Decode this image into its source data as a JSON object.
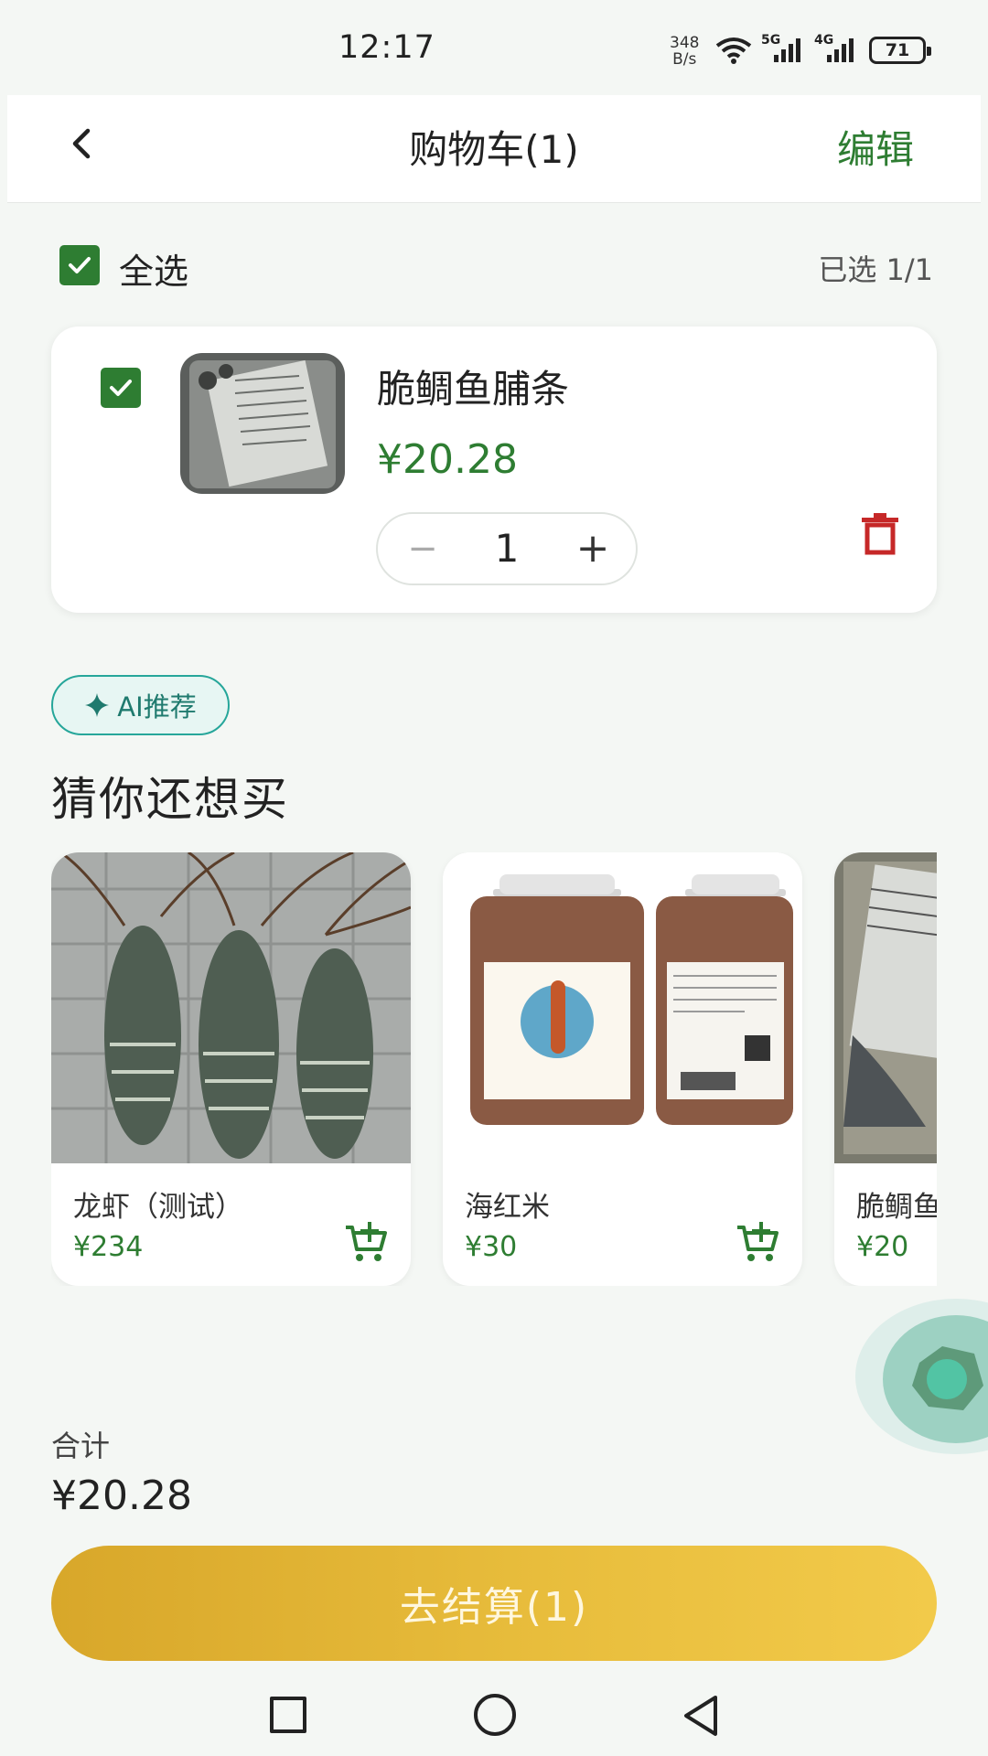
{
  "status_bar": {
    "time": "12:17",
    "net_speed_value": "348",
    "net_speed_unit": "B/s",
    "signal_5g": "5G",
    "signal_4g": "4G",
    "battery": "71"
  },
  "header": {
    "title": "购物车(1)",
    "edit_label": "编辑"
  },
  "selection": {
    "select_all_label": "全选",
    "selected_count": "已选 1/1"
  },
  "cart_item": {
    "name": "脆鲷鱼脯条",
    "price": "¥20.28",
    "quantity": "1",
    "minus_label": "−",
    "plus_label": "+",
    "checked": true
  },
  "recommend": {
    "badge_label": "AI推荐",
    "title": "猜你还想买",
    "products": [
      {
        "name": "龙虾（测试）",
        "price": "¥234"
      },
      {
        "name": "海红米",
        "price": "¥30"
      },
      {
        "name": "脆鲷鱼脯条",
        "price": "¥20"
      }
    ]
  },
  "summary": {
    "total_label": "合计",
    "total_value": "¥20.28",
    "checkout_label": "去结算(1)"
  },
  "colors": {
    "accent_green": "#2e7d32",
    "checkout_gold": "#e8bd3c",
    "ai_teal": "#26a69a",
    "delete_red": "#c62828"
  }
}
